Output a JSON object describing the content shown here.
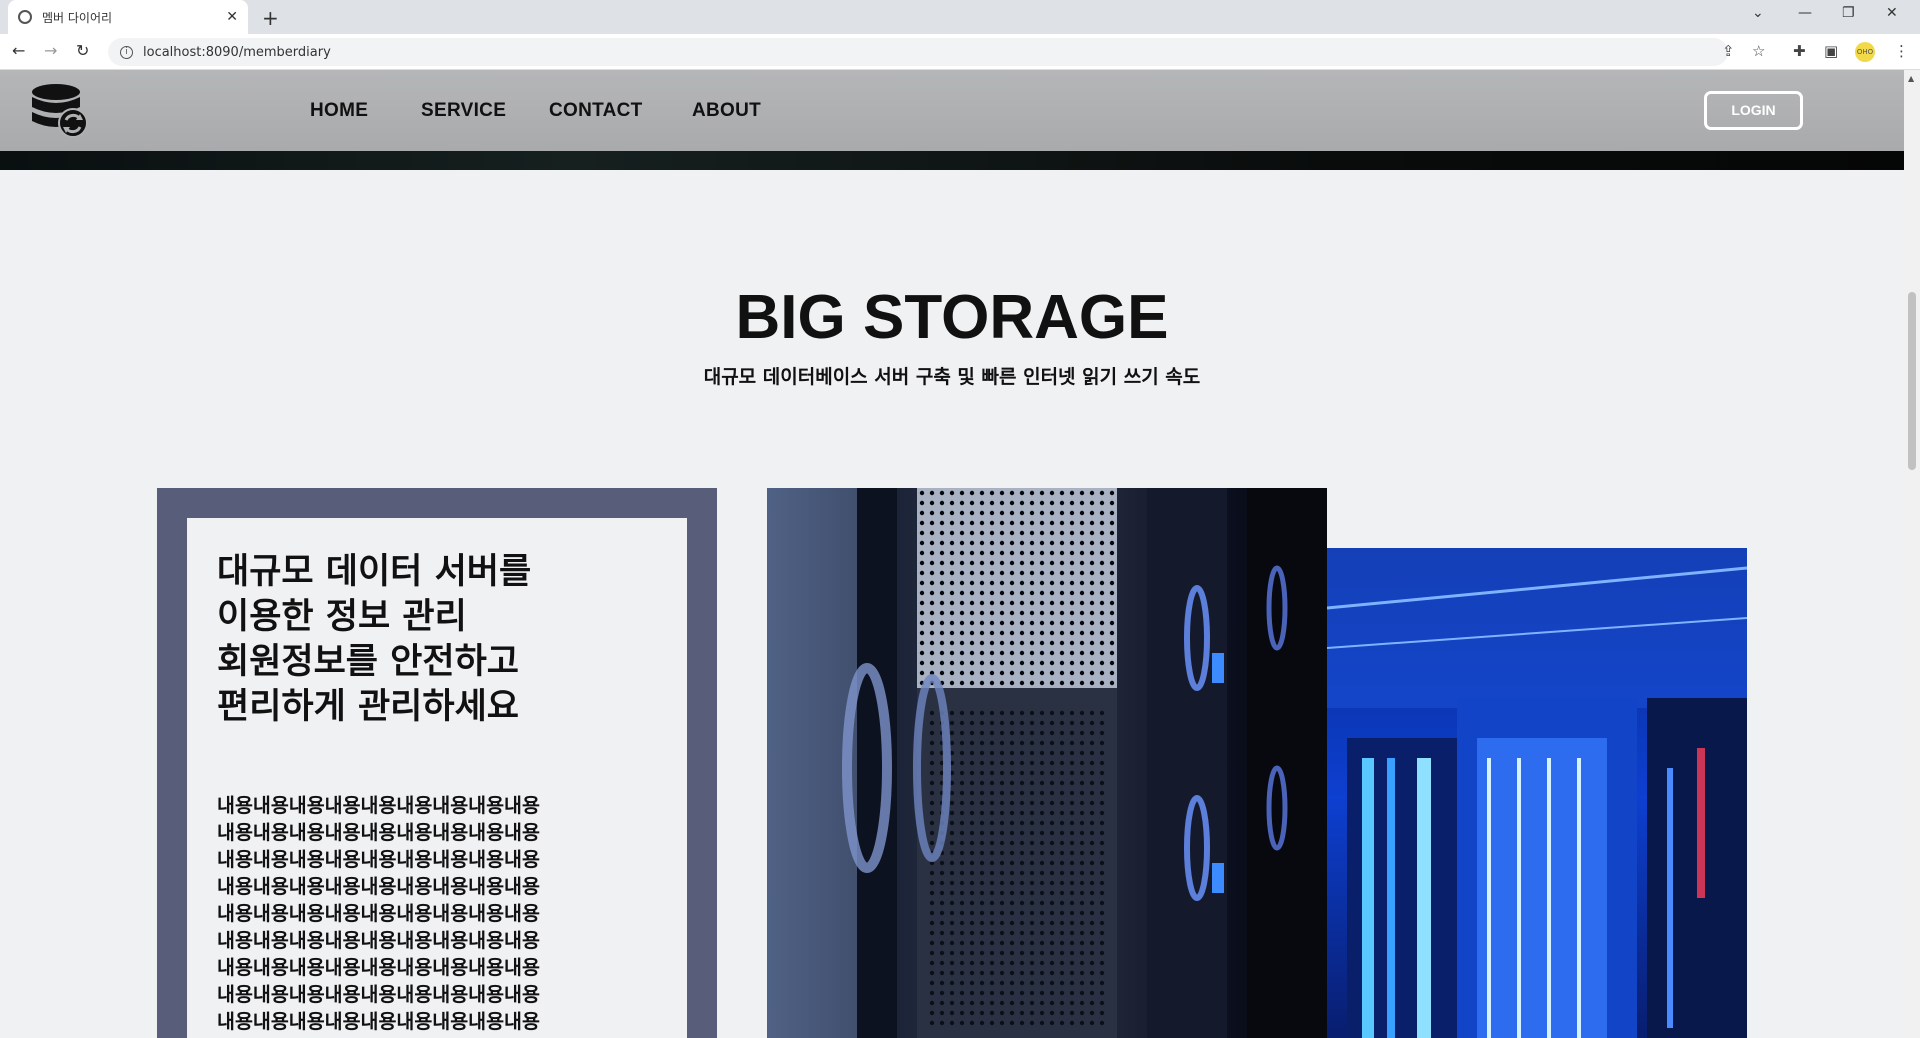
{
  "browser": {
    "tab_title": "멤버 다이어리",
    "url": "localhost:8090/memberdiary",
    "profile_label": "OHO"
  },
  "nav": {
    "items": [
      "HOME",
      "SERVICE",
      "CONTACT",
      "ABOUT"
    ],
    "login_label": "LOGIN"
  },
  "hero": {
    "title": "BIG STORAGE",
    "subtitle": "대규모 데이터베이스 서버 구축 및 빠른 인터넷 읽기 쓰기 속도"
  },
  "card": {
    "title_lines": [
      "대규모 데이터 서버를",
      "이용한 정보 관리",
      "회원정보를 안전하고",
      "편리하게 관리하세요"
    ],
    "body_lines": [
      "내용내용내용내용내용내용내용내용내용",
      "내용내용내용내용내용내용내용내용내용",
      "내용내용내용내용내용내용내용내용내용",
      "내용내용내용내용내용내용내용내용내용",
      "내용내용내용내용내용내용내용내용내용",
      "내용내용내용내용내용내용내용내용내용",
      "내용내용내용내용내용내용내용내용내용",
      "내용내용내용내용내용내용내용내용내용",
      "내용내용내용내용내용내용내용내용내용"
    ]
  },
  "colors": {
    "frame": "#585d79",
    "header": "#b0b1b3",
    "background": "#f0f1f3"
  },
  "icons": {
    "logo": "database-sync-icon",
    "images": [
      "server-rack-closeup-photo",
      "datacenter-aisle-photo"
    ]
  }
}
